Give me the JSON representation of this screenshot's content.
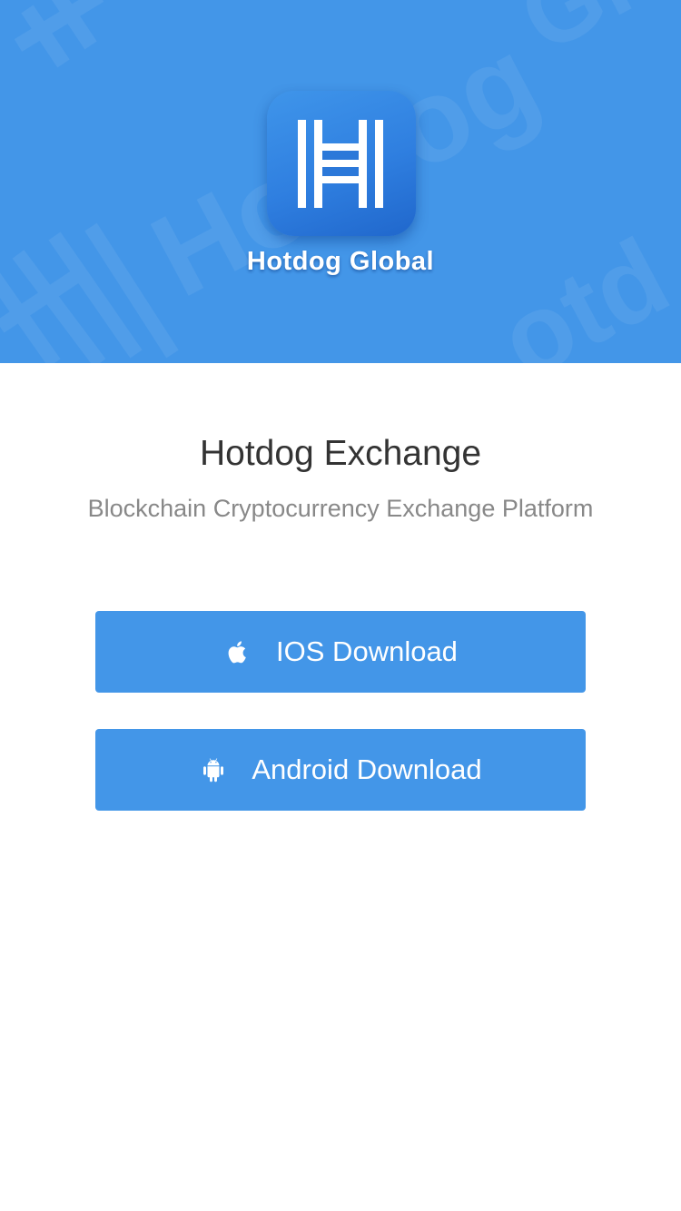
{
  "header": {
    "brand_name": "Hotdog Global",
    "logo_icon": "hotdog-h-logo",
    "background_color": "#4396e8"
  },
  "main": {
    "title": "Hotdog Exchange",
    "subtitle": "Blockchain Cryptocurrency Exchange Platform"
  },
  "downloads": {
    "ios": {
      "label": "IOS Download",
      "icon": "apple-icon"
    },
    "android": {
      "label": "Android Download",
      "icon": "android-icon"
    },
    "button_color": "#4396e8"
  }
}
